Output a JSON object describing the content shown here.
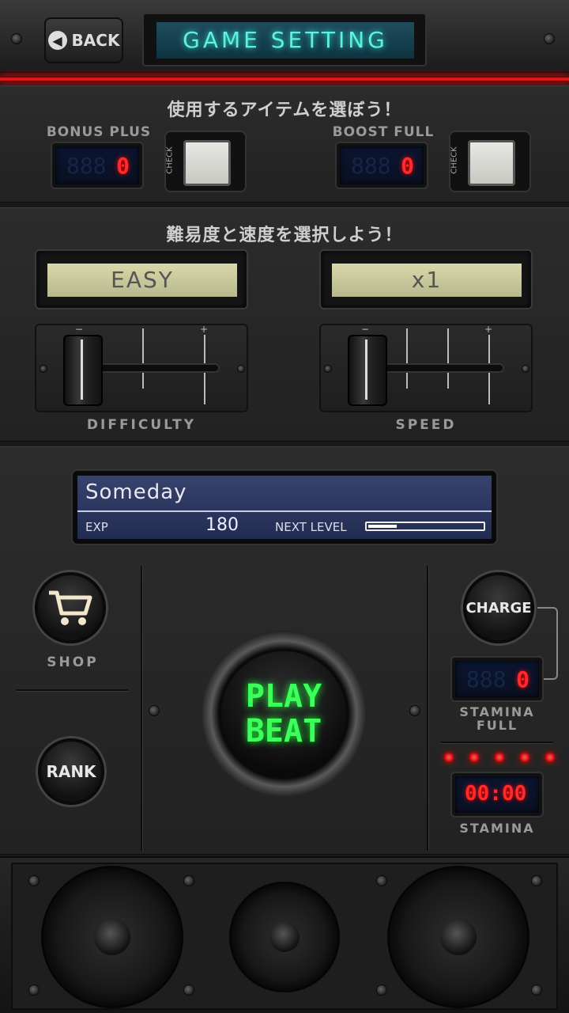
{
  "header": {
    "back_label": "BACK",
    "title": "GAME SETTING"
  },
  "items": {
    "heading": "使用するアイテムを選ぼう！",
    "bonus": {
      "label": "BONUS PLUS",
      "ghost": "888",
      "count": "0",
      "check_label": "CHECK"
    },
    "boost": {
      "label": "BOOST FULL",
      "ghost": "888",
      "count": "0",
      "check_label": "CHECK"
    }
  },
  "difficulty_speed": {
    "heading": "難易度と速度を選択しよう！",
    "difficulty": {
      "value": "EASY",
      "label": "DIFFICULTY",
      "minus": "−",
      "plus": "+"
    },
    "speed": {
      "value": "x1",
      "label": "SPEED",
      "minus": "−",
      "plus": "+"
    }
  },
  "song": {
    "title": "Someday",
    "exp_label": "EXP",
    "exp_value": "180",
    "next_level_label": "NEXT LEVEL",
    "next_level_progress": 0.25
  },
  "shop": {
    "label": "SHOP"
  },
  "rank": {
    "label": "RANK"
  },
  "play": {
    "line1": "PLAY",
    "line2": "BEAT"
  },
  "charge": {
    "label": "CHARGE"
  },
  "stamina_full": {
    "ghost": "888",
    "count": "0",
    "label_line1": "STAMINA",
    "label_line2": "FULL"
  },
  "stamina": {
    "lights": 5,
    "time": "00:00",
    "label": "STAMINA"
  },
  "colors": {
    "accent_red": "#ff2a2a",
    "title_cyan": "#5ff0e0",
    "play_green": "#3dff5a",
    "lcd_yellow": "#d8d8a8"
  }
}
